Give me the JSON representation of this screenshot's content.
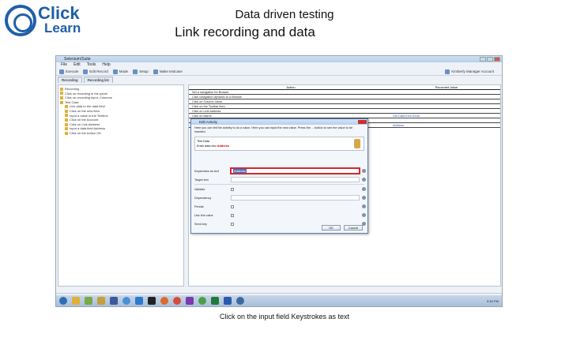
{
  "logo": {
    "word1": "Click",
    "word2": "Learn"
  },
  "slide": {
    "title": "Data driven testing",
    "subtitle": "Link recording and data",
    "caption": "Click on the input field Keystrokes as text"
  },
  "app": {
    "window_title": "Selenium/Suite",
    "menu": [
      "File",
      "Edit",
      "Tools",
      "Help"
    ],
    "toolbar": [
      "Execute",
      "Edit Record",
      "Mode",
      "Setup",
      "Make testcase"
    ],
    "toolbar_right": "Kimberly Manager Account",
    "tabs": [
      "Recording",
      "Recording list"
    ],
    "tree_items": [
      "Recording",
      "Click on recording in the panel",
      "Click on recording input, Columns",
      "Test Case",
      "Link data to the data field",
      "Click on the new item",
      "Input a value in the Textbox",
      "Click on the Account",
      "Click on Link Address",
      "Input a data field Address",
      "Click on the button OK"
    ],
    "grid_headers": [
      "Action",
      "Recorded Value"
    ],
    "grid_rows": [
      {
        "text": "Set a navigation for Browse",
        "value": ""
      },
      {
        "text": "Click navigation dynamic to a Browse",
        "value": ""
      },
      {
        "text": "Click on Column Value",
        "value": ""
      },
      {
        "text": "Click on the Toolbar Item",
        "value": ""
      },
      {
        "text": "Click on Link Address",
        "value": ""
      },
      {
        "text": "Click on Name",
        "value": "Get Data from Excel"
      },
      {
        "text": "Click on the Button Address",
        "value": ""
      },
      {
        "text": "Input a data field Address",
        "value": "Address"
      }
    ],
    "taskbar_icons": [
      "start",
      "explorer",
      "media",
      "chart",
      "app1",
      "browser",
      "ie",
      "folder",
      "firefox",
      "chrome",
      "vs",
      "chrome2",
      "excel",
      "word",
      "app2"
    ],
    "clock": "5:30 PM"
  },
  "dialog": {
    "title": "Edit Activity",
    "instructions": "Here you can tell the activity to do a value. Here you can input the new value. Press the ... button to see the value to be inserted.",
    "info_line1": "Test Data",
    "info_line2_prefix": "Enter data into",
    "info_line2_highlight": "Address",
    "fields": [
      {
        "label": "Keystrokes as text",
        "value": "Address",
        "active": true,
        "type": "text"
      },
      {
        "label": "Target text",
        "value": "",
        "type": "text"
      },
      {
        "label": "Validate",
        "value": "",
        "type": "check"
      },
      {
        "label": "Dependency",
        "value": "",
        "type": "text"
      },
      {
        "label": "Persist",
        "value": "",
        "type": "check"
      },
      {
        "label": "Use link value",
        "value": "",
        "type": "check"
      },
      {
        "label": "Send key",
        "value": "",
        "type": "check"
      }
    ],
    "ok_label": "OK",
    "cancel_label": "Cancel"
  }
}
